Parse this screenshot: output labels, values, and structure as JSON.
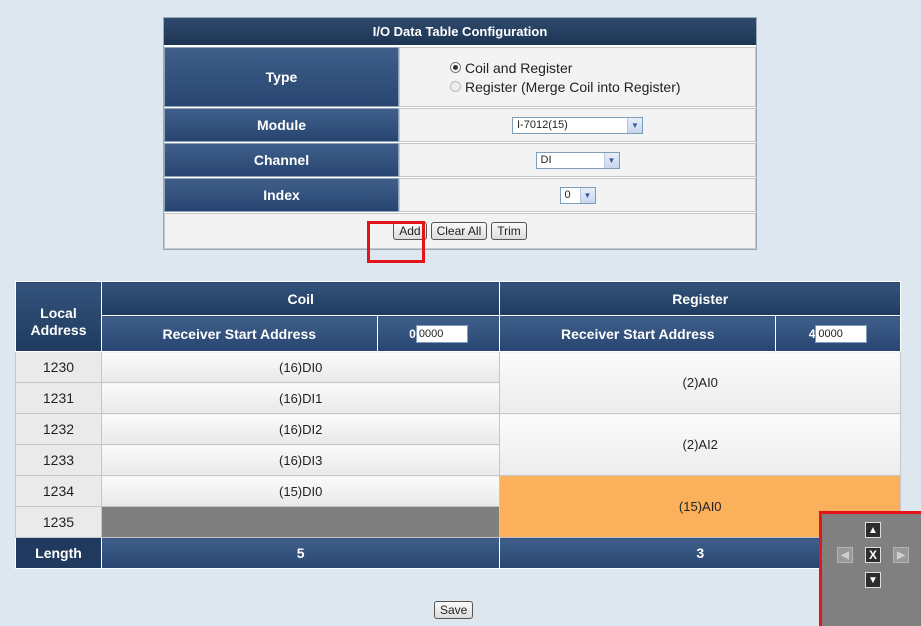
{
  "config": {
    "title": "I/O Data Table Configuration",
    "type_label": "Type",
    "type_options": [
      "Coil and Register",
      "Register (Merge Coil into Register)"
    ],
    "module_label": "Module",
    "module_value": "I-7012(15)",
    "channel_label": "Channel",
    "channel_value": "DI",
    "index_label": "Index",
    "index_value": "0",
    "add_label": "Add",
    "clear_label": "Clear All",
    "trim_label": "Trim"
  },
  "table": {
    "local_address_header": "Local Address",
    "coil_header": "Coil",
    "register_header": "Register",
    "receiver_start_label": "Receiver Start Address",
    "coil_prefix": "0",
    "coil_start_value": "0000",
    "register_prefix": "4",
    "register_start_value": "0000",
    "rows": [
      {
        "addr": "1230",
        "coil": "(16)DI0"
      },
      {
        "addr": "1231",
        "coil": "(16)DI1"
      },
      {
        "addr": "1232",
        "coil": "(16)DI2"
      },
      {
        "addr": "1233",
        "coil": "(16)DI3"
      },
      {
        "addr": "1234",
        "coil": "(15)DI0"
      },
      {
        "addr": "1235",
        "coil": ""
      }
    ],
    "registers": [
      "(2)AI0",
      "(2)AI2",
      "(15)AI0"
    ],
    "length_label": "Length",
    "coil_length": "5",
    "register_length": "3"
  },
  "save_label": "Save",
  "nav": {
    "up": "▲",
    "down": "▼",
    "left": "◀",
    "right": "▶",
    "close": "X"
  },
  "colors": {
    "header": "#1f3a5e",
    "highlight": "#fbb05b",
    "annotation": "#e3141b"
  }
}
